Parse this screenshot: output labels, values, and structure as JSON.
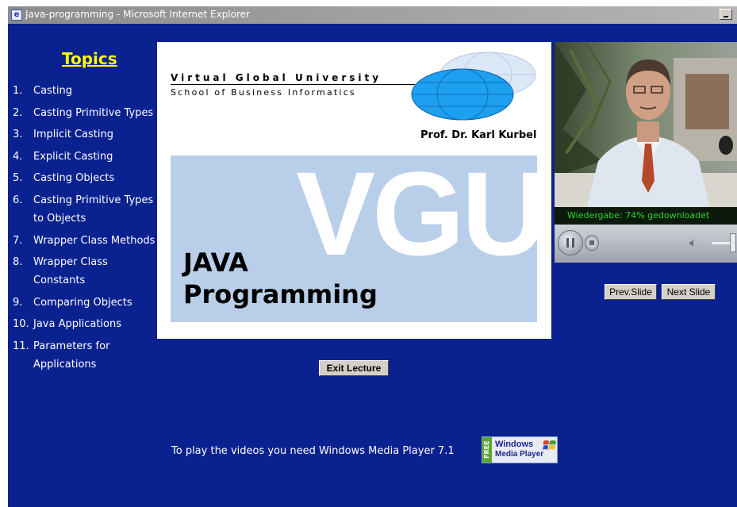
{
  "window": {
    "title": "Java-programming - Microsoft Internet Explorer"
  },
  "sidebar": {
    "heading": "Topics",
    "items": [
      {
        "num": "1.",
        "label": "Casting"
      },
      {
        "num": "2.",
        "label": "Casting Primitive Types"
      },
      {
        "num": "3.",
        "label": "Implicit Casting"
      },
      {
        "num": "4.",
        "label": "Explicit Casting"
      },
      {
        "num": "5.",
        "label": "Casting Objects"
      },
      {
        "num": "6.",
        "label": "Casting Primitive Types to Objects"
      },
      {
        "num": "7.",
        "label": "Wrapper Class Methods"
      },
      {
        "num": "8.",
        "label": "Wrapper Class Constants"
      },
      {
        "num": "9.",
        "label": "Comparing Objects"
      },
      {
        "num": "10.",
        "label": "Java Applications"
      },
      {
        "num": "11.",
        "label": "Parameters for Applications"
      }
    ]
  },
  "slide": {
    "university": "Virtual Global University",
    "school": "School of Business Informatics",
    "professor": "Prof. Dr. Karl Kurbel",
    "logo_text": "VGU",
    "title_line1": "JAVA",
    "title_line2": "Programming"
  },
  "player": {
    "status": "Wiedergabe: 74% gedownloadet",
    "download_progress": 0.74
  },
  "buttons": {
    "prev": "Prev.Slide",
    "next": "Next Slide",
    "exit": "Exit Lecture"
  },
  "footer": {
    "text": "To play the videos you need Windows Media Player 7.1",
    "badge_free": "FREE",
    "badge_line1": "Windows",
    "badge_line2": "Media Player"
  },
  "colors": {
    "background": "#0a2190",
    "topics_heading": "#ffff00",
    "status_text": "#2bd42b",
    "slide_band": "#b9cfe9"
  }
}
